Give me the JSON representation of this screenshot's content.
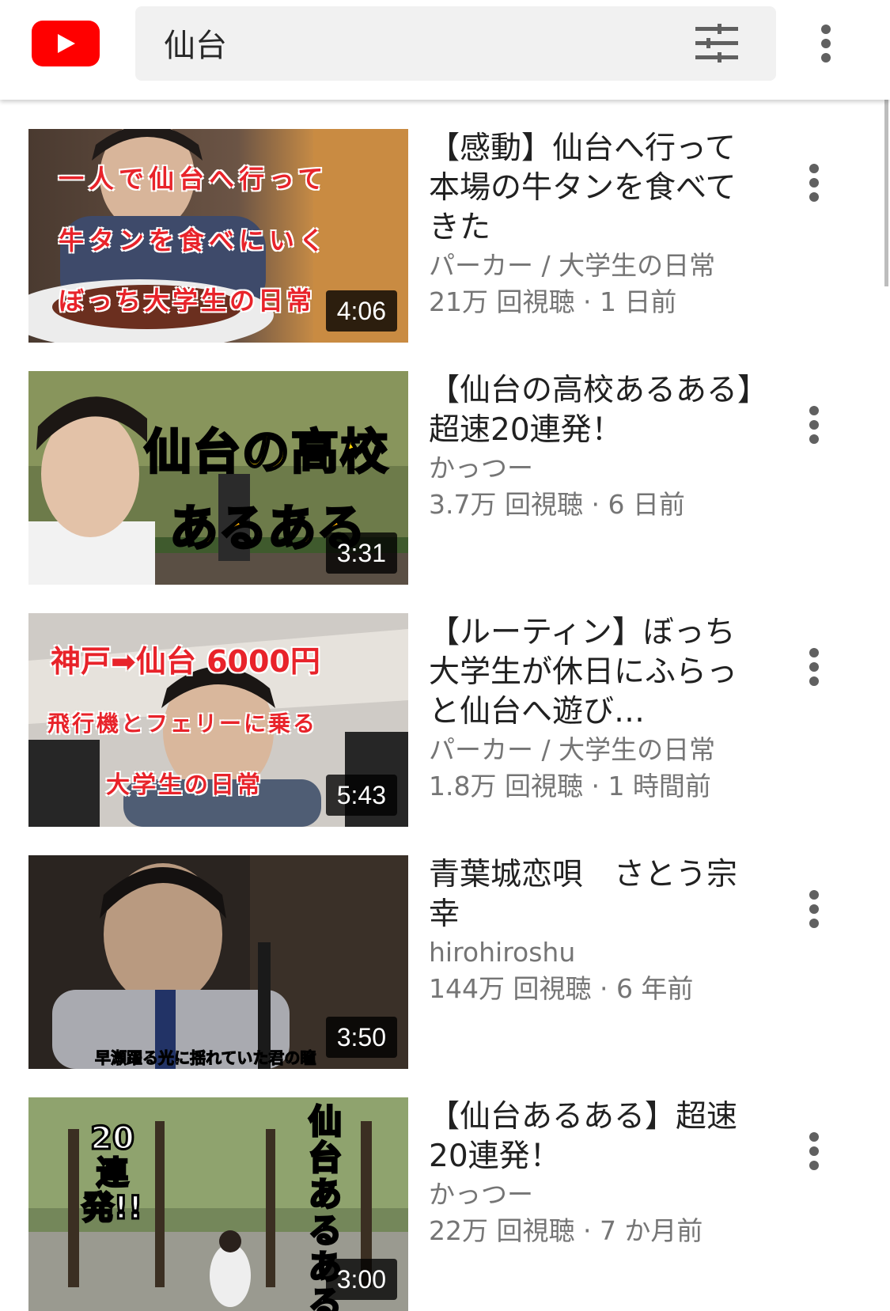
{
  "header": {
    "logo_icon": "youtube-logo-icon",
    "search_value": "仙台",
    "filter_icon": "tune-filter-icon",
    "more_icon": "more-vert-icon",
    "brand_color": "#ff0000"
  },
  "results": [
    {
      "title": "【感動】仙台へ行って本場の牛タンを食べてきた",
      "channel": "パーカー / 大学生の日常",
      "stats": "21万 回視聴 · 1 日前",
      "duration": "4:06",
      "thumb_text": [
        "一人で仙台へ行って",
        "牛タンを食べにいく",
        "ぼっち大学生の日常"
      ]
    },
    {
      "title": "【仙台の高校あるある】超速20連発！",
      "channel": "かっつー",
      "stats": "3.7万 回視聴 · 6 日前",
      "duration": "3:31",
      "thumb_text": [
        "仙台の高校",
        "あるある"
      ]
    },
    {
      "title": "【ルーティン】ぼっち大学生が休日にふらっと仙台へ遊び…",
      "channel": "パーカー / 大学生の日常",
      "stats": "1.8万 回視聴 · 1 時間前",
      "duration": "5:43",
      "thumb_text": [
        "神戸➡仙台 6000円",
        "飛行機とフェリーに乗る",
        "大学生の日常"
      ]
    },
    {
      "title": "青葉城恋唄　さとう宗幸",
      "channel": "hirohiroshu",
      "stats": "144万 回視聴 · 6 年前",
      "duration": "3:50",
      "thumb_text": [
        "早瀬躍る光に揺れていた君の瞳"
      ]
    },
    {
      "title": "【仙台あるある】超速20連発！",
      "channel": "かっつー",
      "stats": "22万 回視聴 · 7 か月前",
      "duration": "3:00",
      "thumb_text": [
        "20連発!!",
        "仙台あるある"
      ]
    }
  ]
}
